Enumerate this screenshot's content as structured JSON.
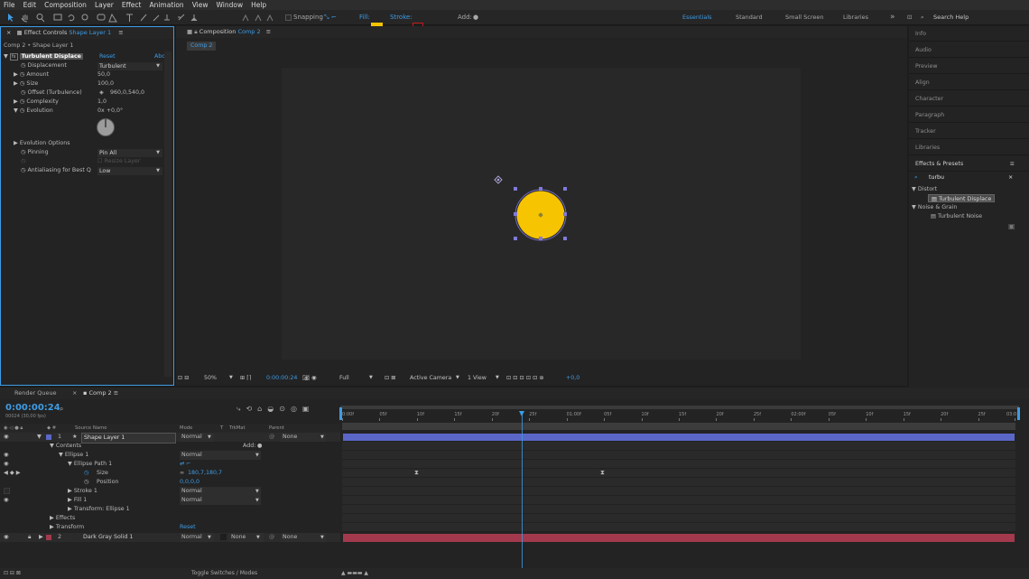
{
  "menu": [
    "File",
    "Edit",
    "Composition",
    "Layer",
    "Effect",
    "Animation",
    "View",
    "Window",
    "Help"
  ],
  "toolbar": {
    "snapping_label": "Snapping",
    "fill_label": "Fill:",
    "stroke_label": "Stroke:",
    "add_label": "Add:",
    "fill_color": "#f6c400",
    "stroke_color": "#c21a1a",
    "workspaces": [
      "Essentials",
      "Standard",
      "Small Screen",
      "Libraries"
    ],
    "search_placeholder": "Search Help"
  },
  "effect_controls": {
    "tab_label": "Effect Controls",
    "tab_layer": "Shape Layer 1",
    "breadcrumb": "Comp 2 • Shape Layer 1",
    "effect_name": "Turbulent Displace",
    "reset_label": "Reset",
    "about_label": "Abo",
    "properties": [
      {
        "name": "Displacement",
        "value": "Turbulent",
        "type": "dropdown"
      },
      {
        "name": "Amount",
        "value": "50,0",
        "type": "value"
      },
      {
        "name": "Size",
        "value": "100,0",
        "type": "value"
      },
      {
        "name": "Offset (Turbulence)",
        "value": "960,0,540,0",
        "type": "point"
      },
      {
        "name": "Complexity",
        "value": "1,0",
        "type": "value"
      },
      {
        "name": "Evolution",
        "value": "0x +0,0°",
        "type": "value"
      }
    ],
    "evolution_options": "Evolution Options",
    "pinning_label": "Pinning",
    "pinning_value": "Pin All",
    "resize_label": "Resize Layer",
    "antialias_label": "Antialiasing for Best Q",
    "antialias_value": "Low"
  },
  "composition": {
    "tab_label": "Composition",
    "tab_name": "Comp 2",
    "sub_tab": "Comp 2",
    "zoom": "50%",
    "timecode": "0:00:00:24",
    "resolution": "Full",
    "camera": "Active Camera",
    "view": "1 View",
    "exposure": "+0,0"
  },
  "right_panels": [
    "Info",
    "Audio",
    "Preview",
    "Align",
    "Character",
    "Paragraph",
    "Tracker",
    "Libraries"
  ],
  "effects_presets": {
    "title": "Effects & Presets",
    "search": "turbu",
    "groups": [
      {
        "name": "Distort",
        "item": "Turbulent Displace"
      },
      {
        "name": "Noise & Grain",
        "item": "Turbulent Noise"
      }
    ]
  },
  "timeline": {
    "tabs": [
      "Render Queue",
      "Comp 2"
    ],
    "timecode": "0:00:00:24",
    "fps": "00024 (30,00 fps)",
    "headers": {
      "source": "Source Name",
      "mode": "Mode",
      "t": "T",
      "trkmat": "TrkMat",
      "parent": "Parent"
    },
    "ruler": [
      "0:00f",
      "05f",
      "10f",
      "15f",
      "20f",
      "25f",
      "01:00f",
      "05f",
      "10f",
      "15f",
      "20f",
      "25f",
      "02:00f",
      "05f",
      "10f",
      "15f",
      "20f",
      "25f",
      "03:0"
    ],
    "layers": {
      "l1_num": "1",
      "l1_name": "Shape Layer 1",
      "l1_mode": "Normal",
      "l1_parent": "None",
      "contents": "Contents",
      "add": "Add:",
      "ellipse1": "Ellipse 1",
      "ellipse1_mode": "Normal",
      "ellipse_path": "Ellipse Path 1",
      "size_label": "Size",
      "size_value": "180,7,180,7",
      "position_label": "Position",
      "position_value": "0,0,0,0",
      "stroke": "Stroke 1",
      "stroke_mode": "Normal",
      "fill": "Fill 1",
      "fill_mode": "Normal",
      "transform_ellipse": "Transform: Ellipse 1",
      "effects": "Effects",
      "transform": "Transform",
      "reset": "Reset",
      "l2_num": "2",
      "l2_name": "Dark Gray Solid 1",
      "l2_mode": "Normal",
      "l2_trkmat": "None",
      "l2_parent": "None"
    },
    "footer": "Toggle Switches / Modes",
    "layer1_color": "#5b67c7",
    "layer2_color": "#a3394c"
  }
}
